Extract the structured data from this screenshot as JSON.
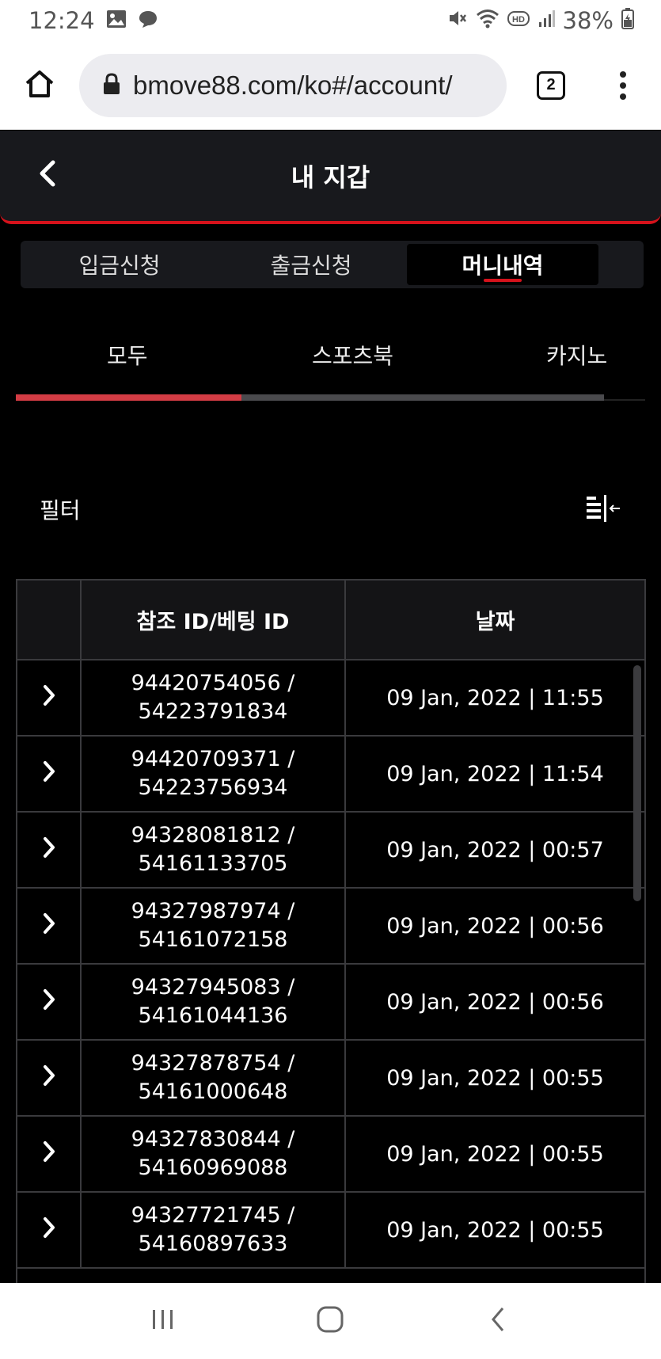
{
  "status_bar": {
    "time": "12:24",
    "battery": "38%",
    "icons": [
      "gallery-icon",
      "chat-bubble-icon",
      "mute-icon",
      "wifi-icon",
      "hd-icon",
      "signal-icon",
      "battery-icon"
    ]
  },
  "browser": {
    "url": "bmove88.com/ko#/account/",
    "tab_count": "2"
  },
  "header": {
    "title": "내 지갑"
  },
  "main_tabs": [
    {
      "label": "입금신청",
      "active": false
    },
    {
      "label": "출금신청",
      "active": false
    },
    {
      "label": "머니내역",
      "active": true
    }
  ],
  "sub_tabs": [
    {
      "label": "모두",
      "active": true
    },
    {
      "label": "스포츠북",
      "active": false
    },
    {
      "label": "카지노",
      "active": false
    }
  ],
  "filter": {
    "label": "필터"
  },
  "table": {
    "headers": [
      "",
      "참조 ID/베팅 ID",
      "날짜"
    ],
    "rows": [
      {
        "ref_id": "94420754056 /",
        "bet_id": "54223791834",
        "date": "09 Jan, 2022 | 11:55"
      },
      {
        "ref_id": "94420709371 /",
        "bet_id": "54223756934",
        "date": "09 Jan, 2022 | 11:54"
      },
      {
        "ref_id": "94328081812 /",
        "bet_id": "54161133705",
        "date": "09 Jan, 2022 | 00:57"
      },
      {
        "ref_id": "94327987974 /",
        "bet_id": "54161072158",
        "date": "09 Jan, 2022 | 00:56"
      },
      {
        "ref_id": "94327945083 /",
        "bet_id": "54161044136",
        "date": "09 Jan, 2022 | 00:56"
      },
      {
        "ref_id": "94327878754 /",
        "bet_id": "54161000648",
        "date": "09 Jan, 2022 | 00:55"
      },
      {
        "ref_id": "94327830844 /",
        "bet_id": "54160969088",
        "date": "09 Jan, 2022 | 00:55"
      },
      {
        "ref_id": "94327721745 /",
        "bet_id": "54160897633",
        "date": "09 Jan, 2022 | 00:55"
      }
    ]
  },
  "colors": {
    "accent": "#d5121b",
    "header_bg": "#18191d",
    "page_bg": "#000000"
  }
}
